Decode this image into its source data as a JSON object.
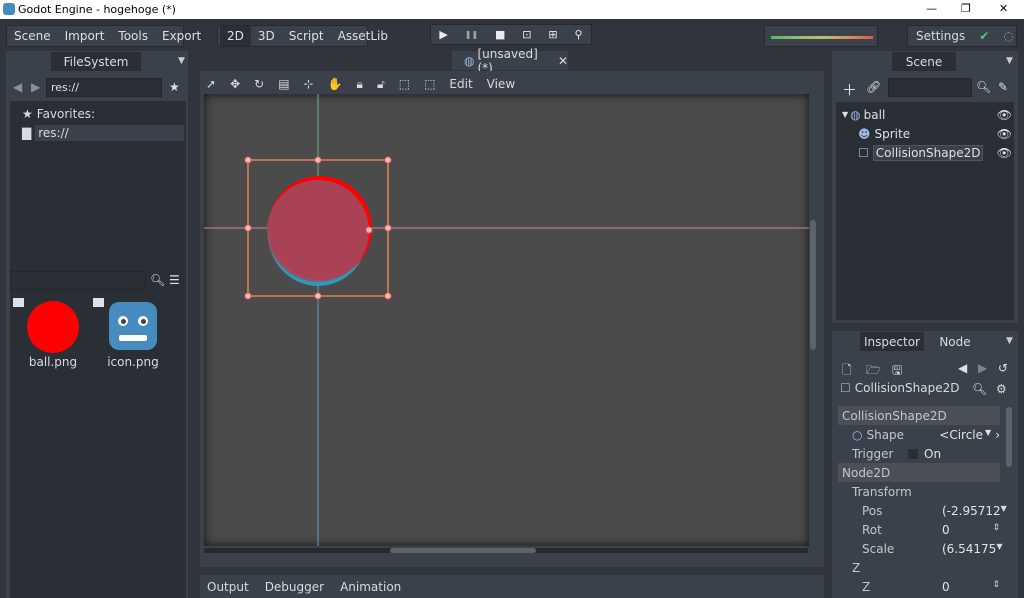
{
  "window": {
    "title": "Godot Engine - hogehoge (*)",
    "minimize": "—",
    "maximize": "❐",
    "close": "✕"
  },
  "menu": {
    "items": [
      "Scene",
      "Import",
      "Tools",
      "Export"
    ]
  },
  "modes": {
    "items": [
      "2D",
      "3D",
      "Script",
      "AssetLib"
    ],
    "selected": "2D"
  },
  "playback": {
    "play": "▶",
    "pause": "❚❚",
    "stop": "■",
    "play_scene": "⊡",
    "play_custom": "⊞",
    "debug": "⚲"
  },
  "settings": {
    "label": "Settings",
    "ok_icon": "✔",
    "spinner_icon": "◌"
  },
  "filesystem": {
    "tab": "FileSystem",
    "path": "res://",
    "favorites_label": "Favorites:",
    "res_label": "res://",
    "files": [
      {
        "name": "ball.png",
        "thumb": "red-circle"
      },
      {
        "name": "icon.png",
        "thumb": "godot-logo"
      }
    ]
  },
  "scene_tab": {
    "label": "[unsaved](*)",
    "close": "✕"
  },
  "toolbar": {
    "edit": "Edit",
    "view": "View"
  },
  "scene_panel": {
    "tab": "Scene",
    "nodes": [
      {
        "name": "ball",
        "level": 0
      },
      {
        "name": "Sprite",
        "level": 1
      },
      {
        "name": "CollisionShape2D",
        "level": 1
      }
    ]
  },
  "inspector": {
    "tab_inspector": "Inspector",
    "tab_node": "Node",
    "object": "CollisionShape2D",
    "section1": "CollisionShape2D",
    "shape_label": "Shape",
    "shape_value": "<Circle",
    "trigger_label": "Trigger",
    "trigger_value": "On",
    "section2": "Node2D",
    "transform_label": "Transform",
    "pos_label": "Pos",
    "pos_value": "(-2.95712",
    "rot_label": "Rot",
    "rot_value": "0",
    "scale_label": "Scale",
    "scale_value": "(6.54175",
    "z_section": "Z",
    "z_label": "Z",
    "z_value": "0"
  },
  "bottom": {
    "tabs": [
      "Output",
      "Debugger",
      "Animation"
    ]
  },
  "colors": {
    "accent": "#478cbf",
    "selection_box": "#e8824c",
    "handle": "#ff8f8f",
    "ball": "#ff0000"
  }
}
